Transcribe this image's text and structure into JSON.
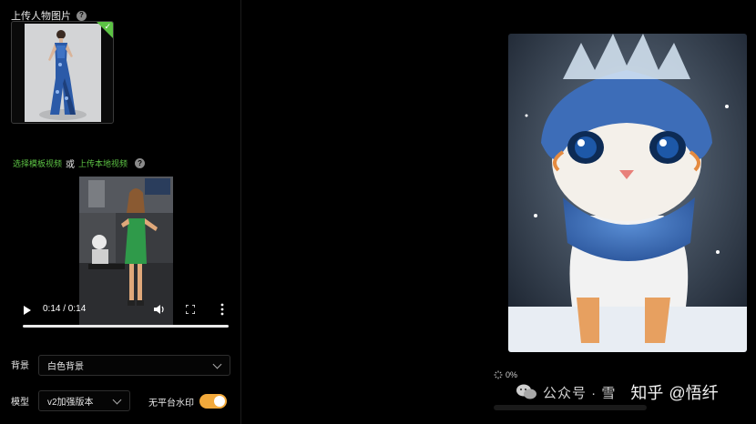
{
  "upload_person": {
    "label": "上传人物图片",
    "help": "?"
  },
  "template": {
    "select_template_link": "选择模板视频",
    "or": "或",
    "upload_local_link": "上传本地视频",
    "help": "?"
  },
  "video_player": {
    "time": "0:14 / 0:14",
    "progress_fraction": 1.0
  },
  "background": {
    "label": "背景",
    "value": "白色背景"
  },
  "model": {
    "label": "模型",
    "value": "v2加强版本"
  },
  "watermark_toggle": {
    "label": "无平台水印",
    "on": true
  },
  "generation": {
    "progress_text": "0%"
  },
  "overlay_watermark": {
    "account": "公众号 · 雪",
    "site": "知乎",
    "author": "@悟纤"
  },
  "colors": {
    "accent_green": "#5cc244",
    "toggle_orange": "#f2a93b"
  }
}
